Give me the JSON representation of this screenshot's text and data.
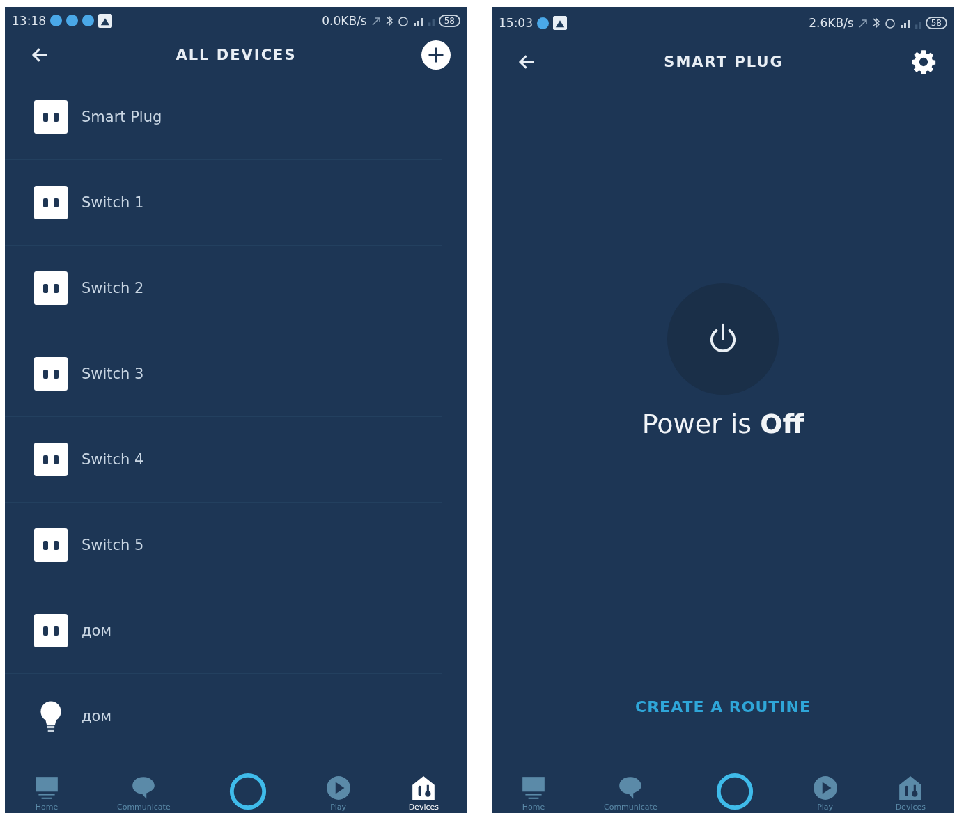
{
  "screens": [
    {
      "kind": "list",
      "status_bar": {
        "time": "13:18",
        "speed": "0.0KB/s",
        "battery": "58",
        "notifications": [
          {
            "kind": "dot"
          },
          {
            "kind": "dot"
          },
          {
            "kind": "dot"
          },
          {
            "kind": "photo"
          }
        ]
      },
      "header": {
        "title": "ALL DEVICES",
        "action": {
          "kind": "add"
        }
      },
      "devices": [
        {
          "name": "Smart Plug",
          "kind": "plug"
        },
        {
          "name": "Switch 1",
          "kind": "plug"
        },
        {
          "name": "Switch 2",
          "kind": "plug"
        },
        {
          "name": "Switch 3",
          "kind": "plug"
        },
        {
          "name": "Switch 4",
          "kind": "plug"
        },
        {
          "name": "Switch 5",
          "kind": "plug"
        },
        {
          "name": "дом",
          "kind": "plug"
        },
        {
          "name": "дом",
          "kind": "bulb"
        }
      ],
      "nav": [
        {
          "label": "Home",
          "kind": "home",
          "selected": false
        },
        {
          "label": "Communicate",
          "kind": "chat",
          "selected": false
        },
        {
          "kind": "alexa",
          "selected": false
        },
        {
          "label": "Play",
          "kind": "play",
          "selected": false
        },
        {
          "label": "Devices",
          "kind": "devices",
          "selected": true
        }
      ]
    },
    {
      "kind": "detail",
      "status_bar": {
        "time": "15:03",
        "speed": "2.6KB/s",
        "battery": "58",
        "notifications": [
          {
            "kind": "dot"
          },
          {
            "kind": "photo"
          }
        ]
      },
      "header": {
        "title": "SMART PLUG",
        "action": {
          "kind": "settings"
        }
      },
      "power": {
        "on": false,
        "text": "Power is **Off**"
      },
      "routine_link": "CREATE A ROUTINE",
      "nav": [
        {
          "label": "Home",
          "kind": "home",
          "selected": false
        },
        {
          "label": "Communicate",
          "kind": "chat",
          "selected": false
        },
        {
          "kind": "alexa",
          "selected": false
        },
        {
          "label": "Play",
          "kind": "play",
          "selected": false
        },
        {
          "label": "Devices",
          "kind": "devices",
          "selected": false
        }
      ]
    }
  ]
}
